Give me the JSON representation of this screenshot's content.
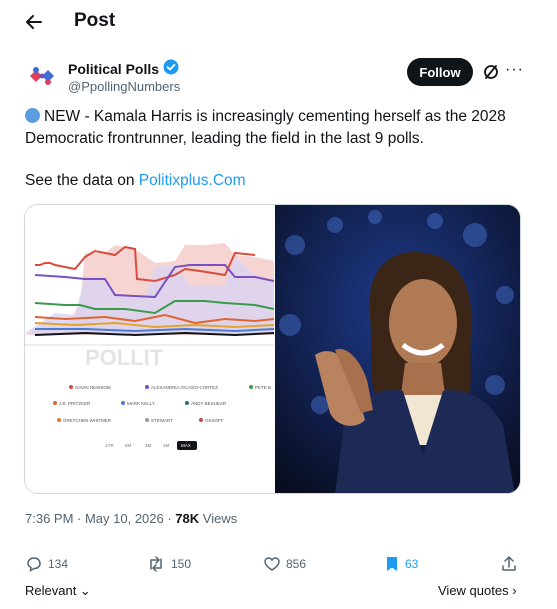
{
  "header": {
    "title": "Post"
  },
  "author": {
    "name": "Political Polls",
    "handle": "@PpollingNumbers",
    "follow_label": "Follow"
  },
  "post": {
    "text": "NEW - Kamala Harris is increasingly cementing herself as the 2028 Democratic frontrunner, leading the field in the last 9 polls.",
    "see_prefix": "See the data on ",
    "link_text": "Politixplus.Com"
  },
  "media": {
    "watermark": "POLLIT",
    "legend": [
      "GAVIN NEWSOM",
      "ALEXANDRIA OCASIO-CORTEZ",
      "PETE B",
      "J.B. PRITZKER",
      "MARK KELLY",
      "ANDY BESHEAR",
      "GRETCHEN WHITMER",
      "STEWART",
      "OSSOFF"
    ],
    "legend_colors": [
      "#d94b3c",
      "#7a4fc2",
      "#3a9b4a",
      "#e0642f",
      "#4a7bd0",
      "#2d6b8a",
      "#e07a2f",
      "#9a9a9a",
      "#c24a4a"
    ],
    "range_buttons": [
      "1YR",
      "6M",
      "3M",
      "1M",
      "MAX"
    ]
  },
  "meta": {
    "time": "7:36 PM · May 10, 2026 · ",
    "views": "78K",
    "views_label": " Views"
  },
  "actions": {
    "replies": "134",
    "reposts": "150",
    "likes": "856",
    "bookmarks": "63"
  },
  "footer": {
    "relevant": "Relevant",
    "view_quotes": "View quotes"
  },
  "colors": {
    "accent": "#1d9bf0",
    "text": "#0f1419",
    "muted": "#536471",
    "verified": "#1d9bf0"
  }
}
